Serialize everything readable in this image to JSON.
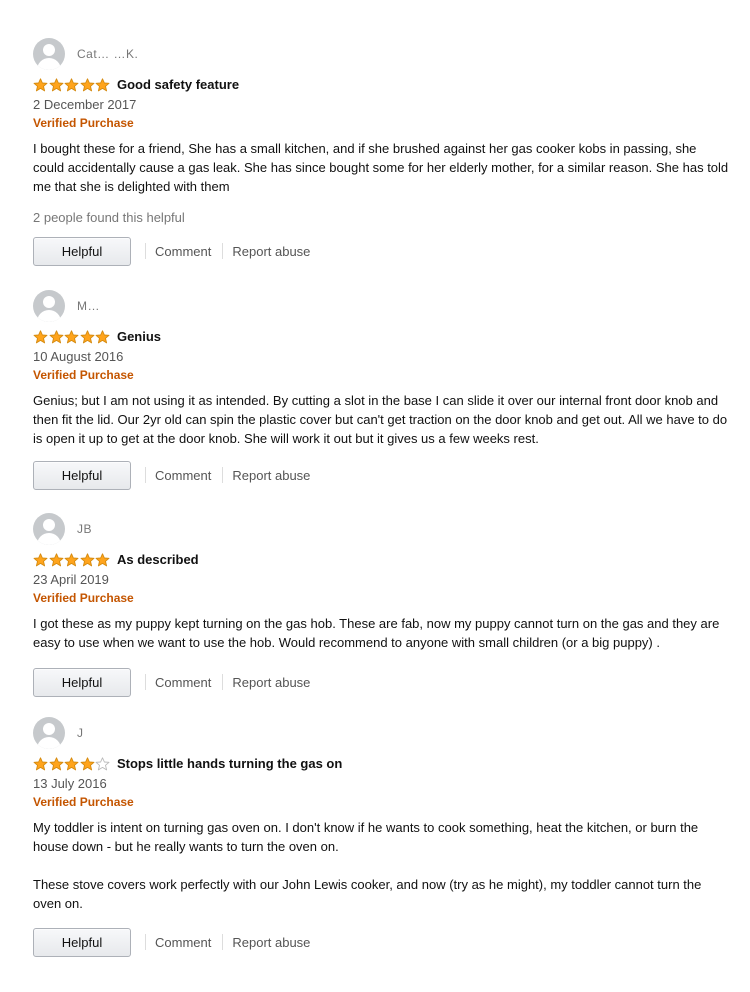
{
  "colors": {
    "star": "#ffa41c",
    "star_stroke": "#d48a0f",
    "verified": "#c45500"
  },
  "reviews": [
    {
      "author": "Cat… …K.",
      "rating": 5,
      "title": "Good safety feature",
      "date": "2 December 2017",
      "verified": "Verified Purchase",
      "paragraphs": [
        "I bought these for a friend, She has a small kitchen, and if she brushed against her gas cooker kobs in passing, she could accidentally cause a gas leak. She has since bought some for her elderly mother, for a similar reason. She has told me that she is delighted with them"
      ],
      "helpful_count": "2 people found this helpful",
      "actions": {
        "helpful": "Helpful",
        "comment": "Comment",
        "report": "Report abuse"
      }
    },
    {
      "author": "M…",
      "rating": 5,
      "title": "Genius",
      "date": "10 August 2016",
      "verified": "Verified Purchase",
      "paragraphs": [
        "Genius; but I am not using it as intended. By cutting a slot in the base I can slide it over our internal front door knob and then fit the lid. Our 2yr old can spin the plastic cover but can't get traction on the door knob and get out. All we have to do is open it up to get at the door knob. She will work it out but it gives us a few weeks rest."
      ],
      "helpful_count": "",
      "actions": {
        "helpful": "Helpful",
        "comment": "Comment",
        "report": "Report abuse"
      }
    },
    {
      "author": "JB",
      "rating": 5,
      "title": "As described",
      "date": "23 April 2019",
      "verified": "Verified Purchase",
      "paragraphs": [
        "I got these as my puppy kept turning on the gas hob. These are fab, now my puppy cannot turn on the gas and they are easy to use when we want to use the hob. Would recommend to anyone with small children (or a big puppy) ."
      ],
      "helpful_count": "",
      "actions": {
        "helpful": "Helpful",
        "comment": "Comment",
        "report": "Report abuse"
      }
    },
    {
      "author": "J",
      "rating": 4,
      "title": "Stops little hands turning the gas on",
      "date": "13 July 2016",
      "verified": "Verified Purchase",
      "paragraphs": [
        "My toddler is intent on turning gas oven on. I don't know if he wants to cook something, heat the kitchen, or burn the house down - but he really wants to turn the oven on.",
        "These stove covers work perfectly with our John Lewis cooker, and now (try as he might), my toddler cannot turn the oven on."
      ],
      "helpful_count": "",
      "actions": {
        "helpful": "Helpful",
        "comment": "Comment",
        "report": "Report abuse"
      }
    }
  ]
}
